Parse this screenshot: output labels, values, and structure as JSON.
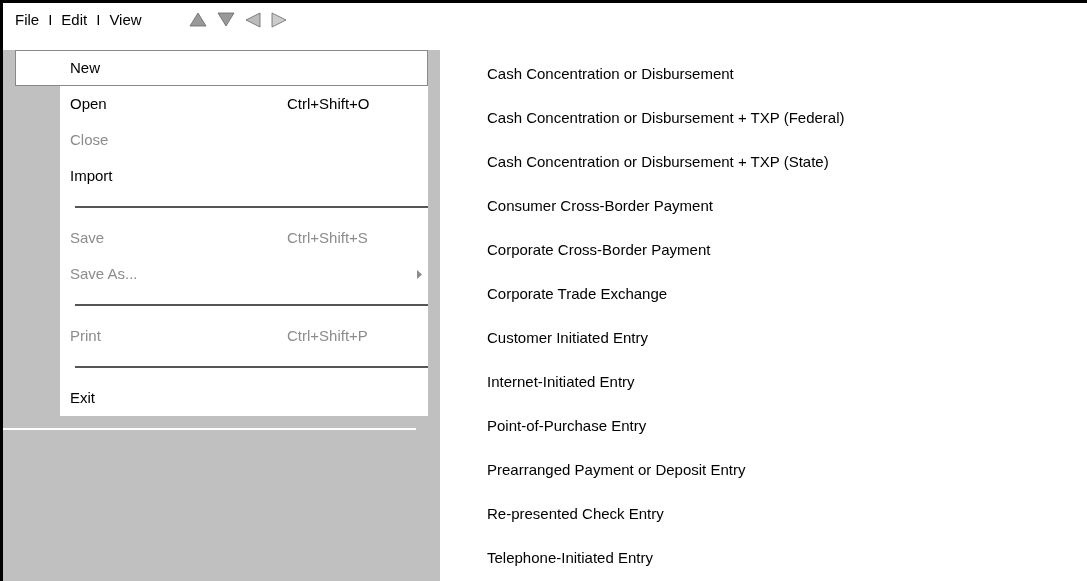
{
  "menubar": [
    {
      "kind": "menu",
      "label": "File"
    },
    {
      "kind": "divider",
      "label": "I"
    },
    {
      "kind": "menu",
      "label": "Edit"
    },
    {
      "kind": "divider",
      "label": "I"
    },
    {
      "kind": "menu",
      "label": "View"
    }
  ],
  "file_menu": [
    {
      "kind": "item",
      "label": "New",
      "selected": true,
      "disabled": false
    },
    {
      "kind": "item",
      "label": "Open",
      "shortcut": "Ctrl+Shift+O",
      "selected": false,
      "disabled": false
    },
    {
      "kind": "item",
      "label": "Close",
      "selected": false,
      "disabled": true
    },
    {
      "kind": "item",
      "label": "Import",
      "selected": false,
      "disabled": false
    },
    {
      "kind": "separator"
    },
    {
      "kind": "item",
      "label": "Save",
      "shortcut": "Ctrl+Shift+S",
      "selected": false,
      "disabled": true
    },
    {
      "kind": "item",
      "label": "Save As...",
      "submenu": true,
      "selected": false,
      "disabled": true
    },
    {
      "kind": "separator"
    },
    {
      "kind": "item",
      "label": "Print",
      "shortcut": "Ctrl+Shift+P",
      "selected": false,
      "disabled": true
    },
    {
      "kind": "separator"
    },
    {
      "kind": "item",
      "label": "Exit",
      "selected": false,
      "disabled": false
    }
  ],
  "new_submenu": [
    "Cash Concentration or Disbursement",
    "Cash Concentration or Disbursement + TXP (Federal)",
    "Cash Concentration or Disbursement + TXP (State)",
    "Consumer Cross-Border Payment",
    "Corporate Cross-Border Payment",
    "Corporate Trade Exchange",
    "Customer Initiated Entry",
    "Internet-Initiated Entry",
    "Point-of-Purchase Entry",
    "Prearranged Payment or Deposit Entry",
    "Re-presented Check Entry",
    "Telephone-Initiated Entry"
  ]
}
